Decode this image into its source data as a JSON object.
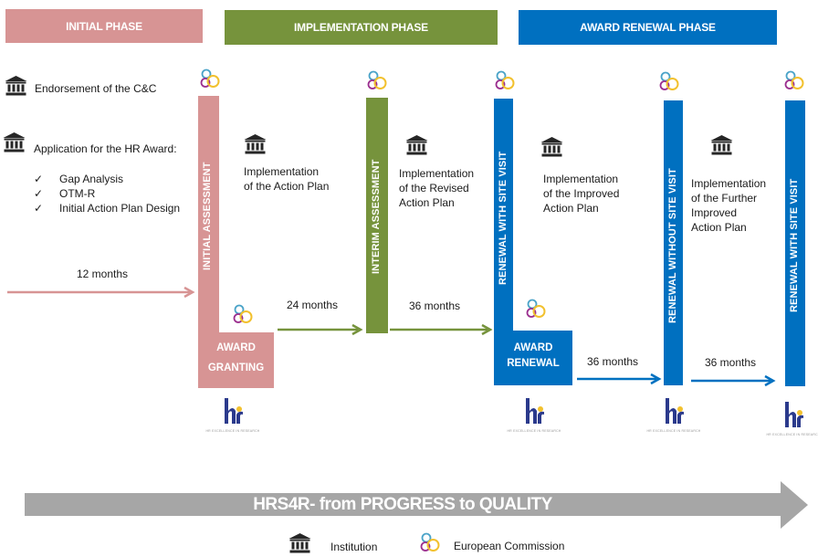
{
  "colors": {
    "initial": "#d79494",
    "implementation": "#76933c",
    "renewal": "#0070c0",
    "progress_arrow": "#a6a6a6",
    "institution_icon": "#262626"
  },
  "phases": [
    {
      "label": "INITIAL PHASE"
    },
    {
      "label": "IMPLEMENTATION PHASE"
    },
    {
      "label": "AWARD RENEWAL PHASE"
    }
  ],
  "left_panel": {
    "endorsement": "Endorsement of the C&C",
    "application": "Application for the HR Award:",
    "checklist": [
      "Gap Analysis",
      "OTM-R",
      "Initial Action Plan Design"
    ],
    "check_glyph": "✓",
    "duration": "12 months"
  },
  "milestones": [
    {
      "vertical_label": "INITIAL ASSESSMENT",
      "foot_label_1": "AWARD",
      "foot_label_2": "GRANTING"
    },
    {
      "vertical_label": "INTERIM ASSESSMENT"
    },
    {
      "vertical_label": "RENEWAL WITH  SITE VISIT",
      "foot_label_1": "AWARD",
      "foot_label_2": "RENEWAL"
    },
    {
      "vertical_label": "RENEWAL WITHOUT  SITE VISIT"
    },
    {
      "vertical_label": "RENEWAL WITH  SITE VISIT"
    }
  ],
  "implementation_steps": [
    {
      "text": "Implementation of the Action Plan",
      "lines": [
        "Implementation",
        "of the Action Plan"
      ]
    },
    {
      "text": "Implementation of the Revised Action Plan",
      "lines": [
        "Implementation",
        "of the Revised",
        "Action Plan"
      ]
    },
    {
      "text": "Implementation of the Improved Action Plan",
      "lines": [
        "Implementation",
        "of the Improved",
        "Action Plan"
      ]
    },
    {
      "text": "Implementation of the Further Improved Action Plan",
      "lines": [
        "Implementation",
        "of the Further",
        "Improved",
        "Action Plan"
      ]
    }
  ],
  "durations": [
    "24 months",
    "36 months",
    "36 months",
    "36 months"
  ],
  "hr_logo": {
    "text": "hr",
    "caption": "HR EXCELLENCE IN RESEARCH"
  },
  "progress_banner": "HRS4R-  from PROGRESS  to QUALITY",
  "legend": [
    {
      "icon": "institution-icon",
      "label": "Institution"
    },
    {
      "icon": "european-commission-icon",
      "label": "European Commission"
    }
  ]
}
